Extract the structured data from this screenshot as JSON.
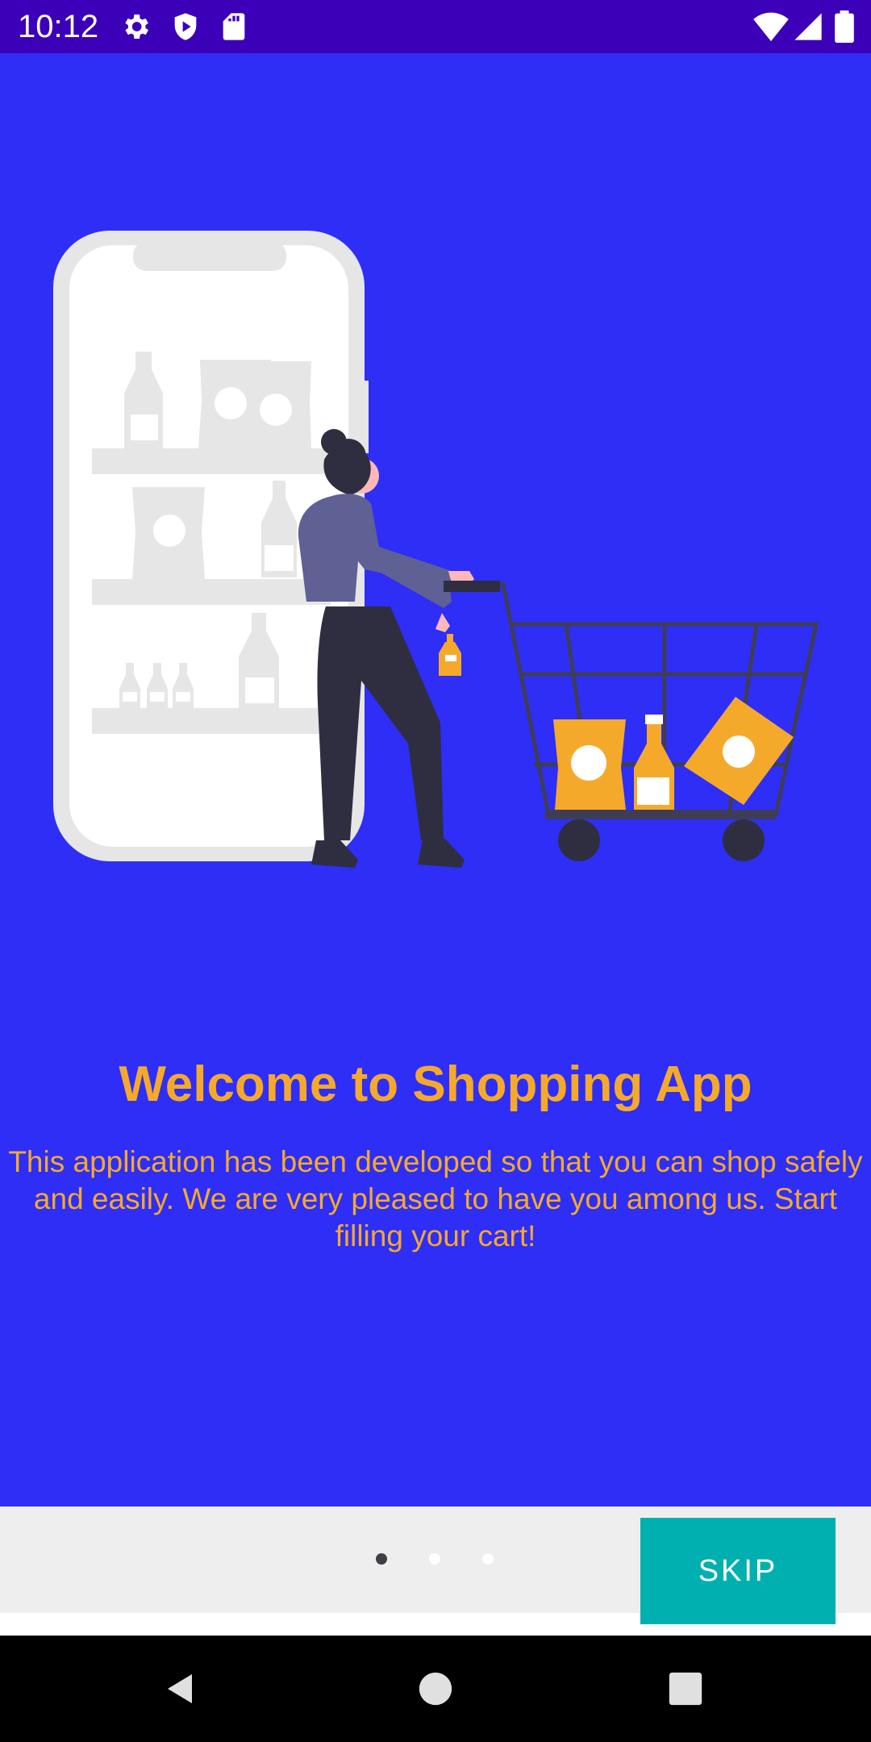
{
  "status_bar": {
    "time": "10:12",
    "left_icons": [
      "gear-icon",
      "shield-play-icon",
      "sd-card-icon"
    ],
    "right_icons": [
      "wifi-icon",
      "signal-icon",
      "battery-icon"
    ]
  },
  "onboarding": {
    "title": "Welcome to Shopping App",
    "description": "This application has been developed so that you can shop safely and easily. We are very pleased to have you among us. Start filling your cart!",
    "page_indicator": {
      "total": 3,
      "current": 1
    },
    "skip_label": "SKIP"
  },
  "colors": {
    "background": "#2e2ef7",
    "status_bar": "#3c00b8",
    "accent_text": "#f5a92b",
    "skip_button": "#00b0b0",
    "bottom_panel": "#eeeeee"
  },
  "nav_bar": {
    "icons": [
      "back-icon",
      "home-icon",
      "recents-icon"
    ]
  }
}
